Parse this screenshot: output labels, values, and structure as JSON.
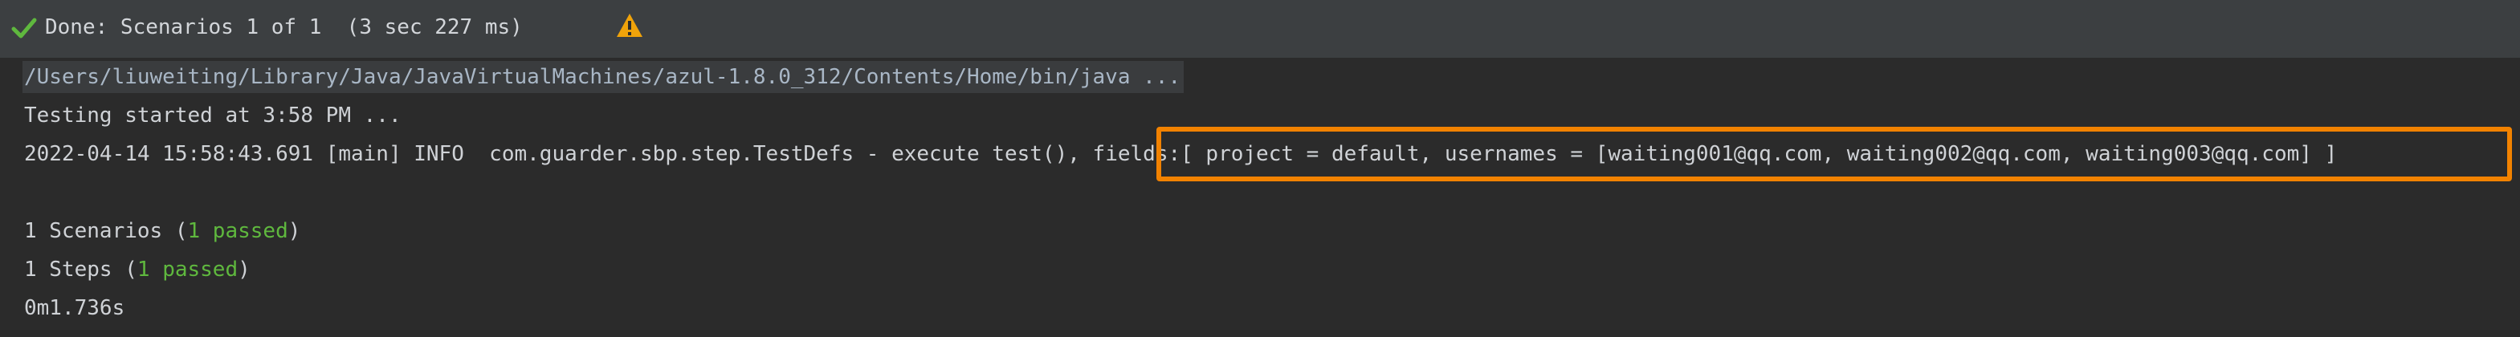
{
  "status_bar": {
    "done_text": "Done: Scenarios 1 of 1  (3 sec 227 ms)",
    "status_icon": "check-icon",
    "warning_icon": "warning-triangle-icon",
    "colors": {
      "check": "#5fb83e",
      "warning": "#f0a30a"
    }
  },
  "console": {
    "java_cmd": "/Users/liuweiting/Library/Java/JavaVirtualMachines/azul-1.8.0_312/Contents/Home/bin/java ...",
    "testing_started": "Testing started at 3:58 PM ...",
    "log_prefix": "2022-04-14 15:58:43.691 [main] INFO  com.guarder.sbp.step.TestDefs - execute test(),",
    "log_fields": "fields:[ project = default, usernames = [waiting001@qq.com, waiting002@qq.com, waiting003@qq.com] ]",
    "scenarios": {
      "prefix": "1 Scenarios (",
      "passed": "1 passed",
      "suffix": ")"
    },
    "steps": {
      "prefix": "1 Steps (",
      "passed": "1 passed",
      "suffix": ")"
    },
    "duration": "0m1.736s",
    "highlight_color": "#f28200"
  }
}
